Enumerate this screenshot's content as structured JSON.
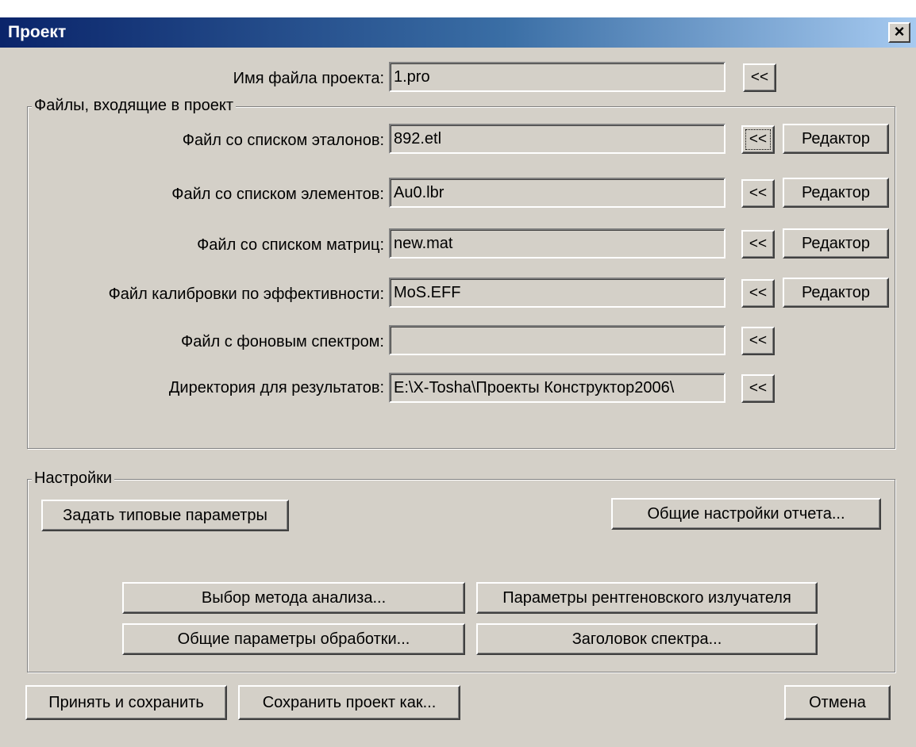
{
  "window": {
    "title": "Проект",
    "close": "×"
  },
  "project_file": {
    "label": "Имя файла проекта:",
    "value": "1.pro",
    "browse": "<<"
  },
  "files_group": {
    "title": "Файлы, входящие в проект",
    "rows": [
      {
        "label": "Файл со списком эталонов:",
        "value": "892.etl",
        "browse": "<<",
        "editor": "Редактор"
      },
      {
        "label": "Файл со списком элементов:",
        "value": "Au0.lbr",
        "browse": "<<",
        "editor": "Редактор"
      },
      {
        "label": "Файл со списком матриц:",
        "value": "new.mat",
        "browse": "<<",
        "editor": "Редактор"
      },
      {
        "label": "Файл калибровки по эффективности:",
        "value": "MoS.EFF",
        "browse": "<<",
        "editor": "Редактор"
      },
      {
        "label": "Файл с фоновым спектром:",
        "value": "",
        "browse": "<<"
      },
      {
        "label": "Директория для результатов:",
        "value": "E:\\X-Tosha\\Проекты Конструктор2006\\",
        "browse": "<<"
      }
    ]
  },
  "settings_group": {
    "title": "Настройки",
    "set_typical": "Задать типовые параметры",
    "report_settings": "Общие настройки отчета...",
    "analysis_method": "Выбор метода анализа...",
    "xray_params": "Параметры рентгеновского излучателя",
    "processing_params": "Общие параметры обработки...",
    "spectrum_header": "Заголовок спектра..."
  },
  "footer": {
    "accept_save": "Принять и сохранить",
    "save_as": "Сохранить проект как...",
    "cancel": "Отмена"
  }
}
